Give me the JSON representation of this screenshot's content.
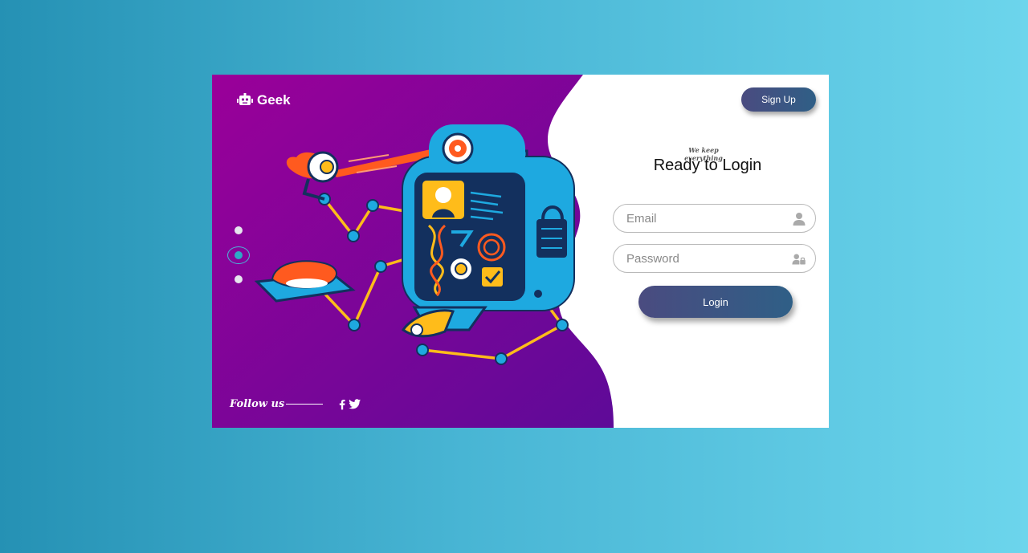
{
  "brand": {
    "name": "Geek",
    "icon": "robot-icon"
  },
  "header": {
    "signup_label": "Sign Up"
  },
  "form": {
    "tagline": "We keep everything",
    "title": "Ready to Login",
    "email_placeholder": "Email",
    "email_icon": "user-icon",
    "password_placeholder": "Password",
    "password_icon": "user-lock-icon",
    "login_label": "Login"
  },
  "carousel": {
    "slide_count": 3,
    "active_index": 1
  },
  "footer": {
    "follow_label": "Follow us",
    "social": [
      "facebook-icon",
      "twitter-icon"
    ]
  },
  "colors": {
    "purple_start": "#9a0099",
    "purple_end": "#5e0a98",
    "button_start": "#4a4b80",
    "button_end": "#2f5f86",
    "robot_blue": "#1ea9e0",
    "accent_orange": "#ff5a1f",
    "accent_yellow": "#ffbc1a"
  }
}
